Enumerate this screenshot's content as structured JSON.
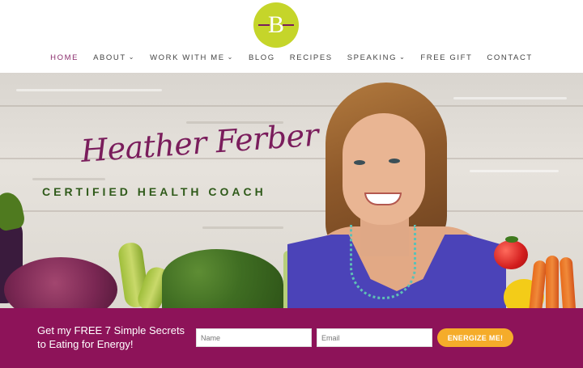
{
  "logo": {
    "letter": "B"
  },
  "nav": {
    "items": [
      {
        "label": "HOME",
        "active": true,
        "dropdown": false
      },
      {
        "label": "ABOUT",
        "active": false,
        "dropdown": true
      },
      {
        "label": "WORK WITH ME",
        "active": false,
        "dropdown": true
      },
      {
        "label": "BLOG",
        "active": false,
        "dropdown": false
      },
      {
        "label": "RECIPES",
        "active": false,
        "dropdown": false
      },
      {
        "label": "SPEAKING",
        "active": false,
        "dropdown": true
      },
      {
        "label": "FREE GIFT",
        "active": false,
        "dropdown": false
      },
      {
        "label": "CONTACT",
        "active": false,
        "dropdown": false
      }
    ],
    "chevron_glyph": "⌄"
  },
  "hero": {
    "signature": "Heather Ferber",
    "tagline": "CERTIFIED HEALTH COACH"
  },
  "optin": {
    "headline": "Get my FREE 7 Simple Secrets to Eating for Energy!",
    "name_placeholder": "Name",
    "email_placeholder": "Email",
    "button_label": "ENERGIZE ME!"
  },
  "colors": {
    "brand_purple": "#8d1359",
    "logo_green": "#c5d52a",
    "button_orange": "#f5ac2a",
    "tagline_green": "#2f5a1a"
  }
}
